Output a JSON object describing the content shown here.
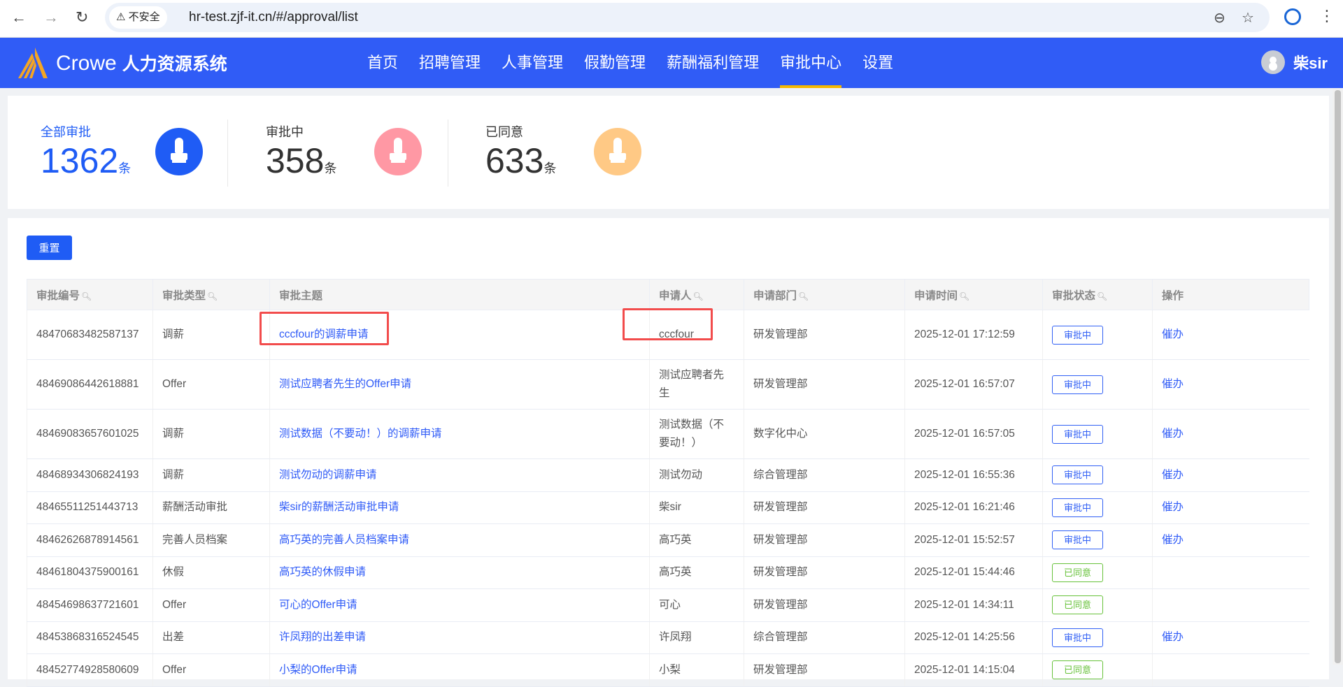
{
  "browser": {
    "back": "←",
    "forward": "→",
    "reload": "↻",
    "security": "⚠ 不安全",
    "url": "hr-test.zjf-it.cn/#/approval/list",
    "zoom_icon": "zoom-out-icon",
    "star_icon": "star-icon"
  },
  "header": {
    "brand": "Crowe",
    "system": "人力资源系统",
    "nav": [
      "首页",
      "招聘管理",
      "人事管理",
      "假勤管理",
      "薪酬福利管理",
      "审批中心",
      "设置"
    ],
    "active": "审批中心",
    "user": "柴sir"
  },
  "stats": [
    {
      "label": "全部审批",
      "value": "1362",
      "unit": "条",
      "color": "#1f5cf5"
    },
    {
      "label": "审批中",
      "value": "358",
      "unit": "条",
      "color": "#ff98a4"
    },
    {
      "label": "已同意",
      "value": "633",
      "unit": "条",
      "color": "#ffc985"
    }
  ],
  "toolbar": {
    "reset": "重置"
  },
  "table": {
    "columns": [
      "审批编号",
      "审批类型",
      "审批主题",
      "申请人",
      "申请部门",
      "申请时间",
      "审批状态",
      "操作"
    ],
    "rows": [
      {
        "id": "48470683482587137",
        "type": "调薪",
        "subject": "cccfour的调薪申请",
        "applicant": "cccfour",
        "dept": "研发管理部",
        "time": "2025-12-01 17:12:59",
        "status": "审批中",
        "action": "催办"
      },
      {
        "id": "48469086442618881",
        "type": "Offer",
        "subject": "测试应聘者先生的Offer申请",
        "applicant": "测试应聘者先生",
        "dept": "研发管理部",
        "time": "2025-12-01 16:57:07",
        "status": "审批中",
        "action": "催办"
      },
      {
        "id": "48469083657601025",
        "type": "调薪",
        "subject": "测试数据（不要动！）的调薪申请",
        "applicant": "测试数据（不要动！）",
        "dept": "数字化中心",
        "time": "2025-12-01 16:57:05",
        "status": "审批中",
        "action": "催办"
      },
      {
        "id": "48468934306824193",
        "type": "调薪",
        "subject": "测试勿动的调薪申请",
        "applicant": "测试勿动",
        "dept": "综合管理部",
        "time": "2025-12-01 16:55:36",
        "status": "审批中",
        "action": "催办"
      },
      {
        "id": "48465511251443713",
        "type": "薪酬活动审批",
        "subject": "柴sir的薪酬活动审批申请",
        "applicant": "柴sir",
        "dept": "研发管理部",
        "time": "2025-12-01 16:21:46",
        "status": "审批中",
        "action": "催办"
      },
      {
        "id": "48462626878914561",
        "type": "完善人员档案",
        "subject": "高巧英的完善人员档案申请",
        "applicant": "高巧英",
        "dept": "研发管理部",
        "time": "2025-12-01 15:52:57",
        "status": "审批中",
        "action": "催办"
      },
      {
        "id": "48461804375900161",
        "type": "休假",
        "subject": "高巧英的休假申请",
        "applicant": "高巧英",
        "dept": "研发管理部",
        "time": "2025-12-01 15:44:46",
        "status": "已同意",
        "action": ""
      },
      {
        "id": "48454698637721601",
        "type": "Offer",
        "subject": "可心的Offer申请",
        "applicant": "可心",
        "dept": "研发管理部",
        "time": "2025-12-01 14:34:11",
        "status": "已同意",
        "action": ""
      },
      {
        "id": "48453868316524545",
        "type": "出差",
        "subject": "许凤翔的出差申请",
        "applicant": "许凤翔",
        "dept": "综合管理部",
        "time": "2025-12-01 14:25:56",
        "status": "审批中",
        "action": "催办"
      },
      {
        "id": "48452774928580609",
        "type": "Offer",
        "subject": "小梨的Offer申请",
        "applicant": "小梨",
        "dept": "研发管理部",
        "time": "2025-12-01 14:15:04",
        "status": "已同意",
        "action": ""
      }
    ]
  }
}
